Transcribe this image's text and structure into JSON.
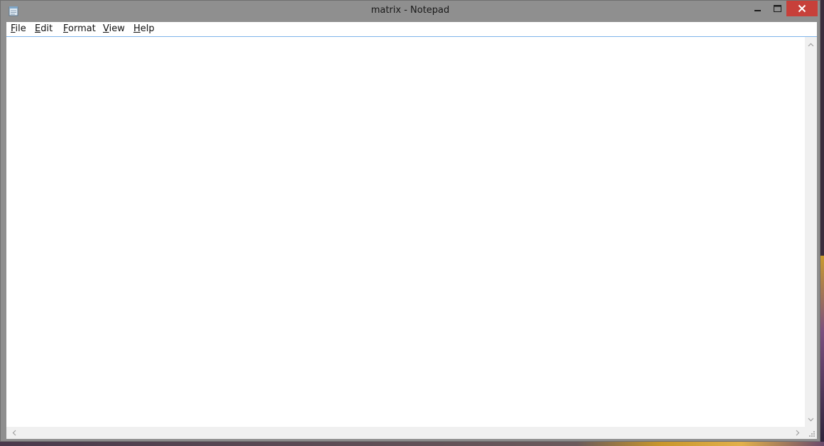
{
  "window": {
    "title": "matrix - Notepad"
  },
  "titlebar": {
    "icon": "notepad-icon",
    "buttons": {
      "minimize": "minimize-icon",
      "maximize": "maximize-icon",
      "close": "close-icon"
    },
    "close_color": "#c7403a"
  },
  "menu": {
    "file": {
      "accel": "F",
      "rest": "ile"
    },
    "edit": {
      "accel": "E",
      "rest": "dit"
    },
    "format": {
      "accel": "F",
      "rest": "ormat",
      "prefix": ""
    },
    "view": {
      "accel": "V",
      "rest": "iew"
    },
    "help": {
      "accel": "H",
      "rest": "elp"
    }
  },
  "editor": {
    "content": ""
  },
  "colors": {
    "frame": "#8f8f8f",
    "menu_border": "#7eb4ea",
    "scrollbar": "#f0f0f0"
  }
}
